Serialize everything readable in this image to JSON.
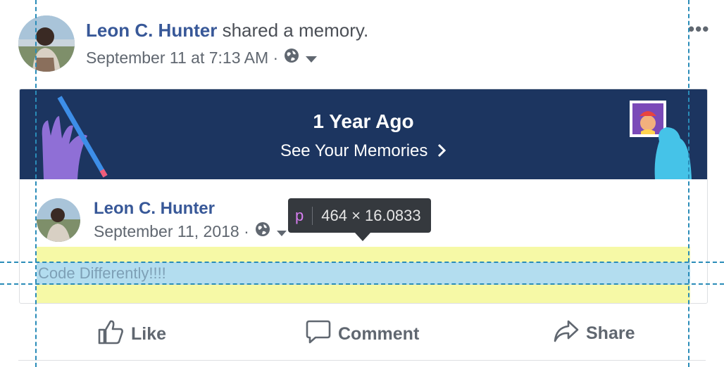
{
  "post": {
    "author": "Leon C. Hunter",
    "action_text": "shared a memory.",
    "timestamp": "September 11 at 7:13 AM ·",
    "privacy_icon": "globe-icon",
    "dropdown_icon": "caret-down-icon",
    "more_label": "•••"
  },
  "memory_banner": {
    "title": "1 Year Ago",
    "link_label": "See Your Memories",
    "link_icon": "chevron-right-icon",
    "background_color": "#1c3560"
  },
  "shared_post": {
    "author": "Leon C. Hunter",
    "date": "September 11, 2018 ·",
    "privacy_icon": "globe-icon",
    "dropdown_icon": "caret-down-icon",
    "text": "Code Differently!!!!"
  },
  "inspector_tooltip": {
    "tag": "p",
    "dimensions": "464 × 16.0833"
  },
  "actions": {
    "like": "Like",
    "comment": "Comment",
    "share": "Share"
  },
  "colors": {
    "link": "#385898",
    "muted": "#606770",
    "highlight_margin": "#f6f9a6",
    "highlight_content": "#b3ddef"
  }
}
